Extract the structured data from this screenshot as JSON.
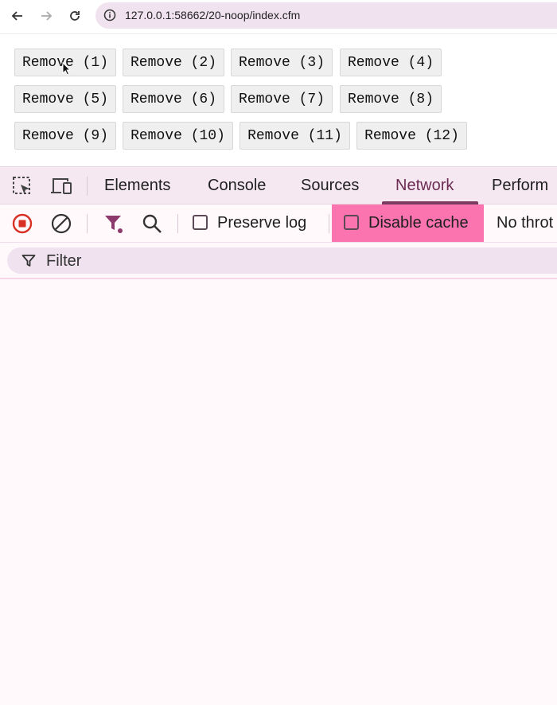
{
  "browser": {
    "back_icon": "arrow-left-icon",
    "forward_icon": "arrow-right-icon",
    "reload_icon": "reload-icon",
    "site_info_icon": "info-icon",
    "url": "127.0.0.1:58662/20-noop/index.cfm"
  },
  "page": {
    "buttons": [
      "Remove (1)",
      "Remove (2)",
      "Remove (3)",
      "Remove (4)",
      "Remove (5)",
      "Remove (6)",
      "Remove (7)",
      "Remove (8)",
      "Remove (9)",
      "Remove (10)",
      "Remove (11)",
      "Remove (12)"
    ]
  },
  "devtools": {
    "tabs": [
      "Elements",
      "Console",
      "Sources",
      "Network",
      "Perform"
    ],
    "active_tab": "Network",
    "toolbar": {
      "preserve_log_label": "Preserve log",
      "disable_cache_label": "Disable cache",
      "throttling_label": "No throt",
      "preserve_log_checked": false,
      "disable_cache_checked": false
    },
    "filter": {
      "placeholder": "Filter"
    }
  },
  "colors": {
    "active_tab": "#6d2c54",
    "record_red": "#d93025",
    "highlight_pink": "#fb74b0",
    "filter_accent": "#8b3a6b"
  }
}
